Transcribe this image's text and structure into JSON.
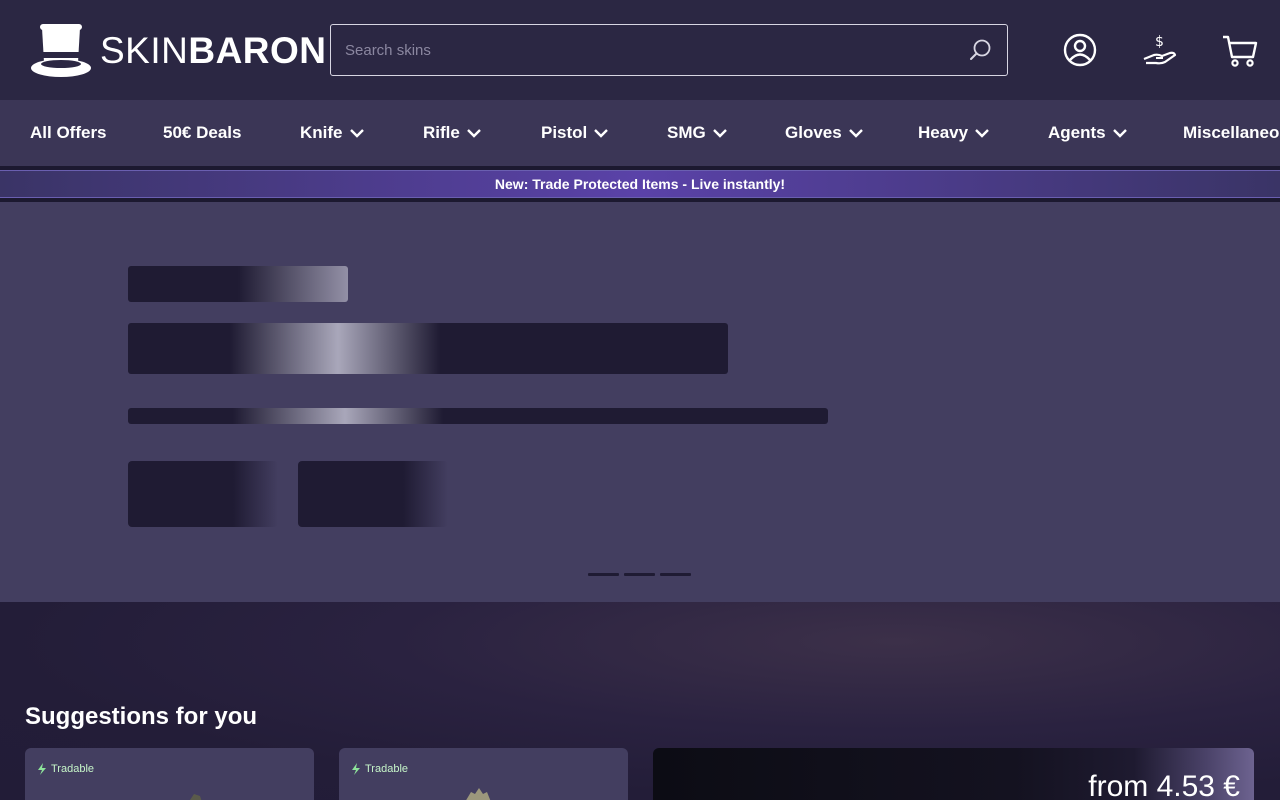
{
  "brand": {
    "name_thin": "SKIN",
    "name_bold": "BARON"
  },
  "search": {
    "placeholder": "Search skins"
  },
  "header_icons": [
    "account-icon",
    "sell-money-hand-icon",
    "cart-icon"
  ],
  "nav": {
    "items": [
      {
        "label": "All Offers",
        "dropdown": false
      },
      {
        "label": "50€ Deals",
        "dropdown": false
      },
      {
        "label": "Knife",
        "dropdown": true
      },
      {
        "label": "Rifle",
        "dropdown": true
      },
      {
        "label": "Pistol",
        "dropdown": true
      },
      {
        "label": "SMG",
        "dropdown": true
      },
      {
        "label": "Gloves",
        "dropdown": true
      },
      {
        "label": "Heavy",
        "dropdown": true
      },
      {
        "label": "Agents",
        "dropdown": true
      },
      {
        "label": "Miscellaneous",
        "dropdown": false
      }
    ]
  },
  "banner": {
    "text": "New: Trade Protected Items - Live instantly!"
  },
  "hero": {
    "slide_count": 3
  },
  "suggestions": {
    "title": "Suggestions for you",
    "cards": [
      {
        "badge": "Tradable"
      },
      {
        "badge": "Tradable"
      }
    ],
    "promo": {
      "text": "from 4.53 €"
    }
  },
  "colors": {
    "header_bg": "#2b2743",
    "nav_bg": "#3b3656",
    "hero_bg": "#433e60",
    "banner_accent": "#5a42a8",
    "tradable_green": "#c6f5c9"
  }
}
